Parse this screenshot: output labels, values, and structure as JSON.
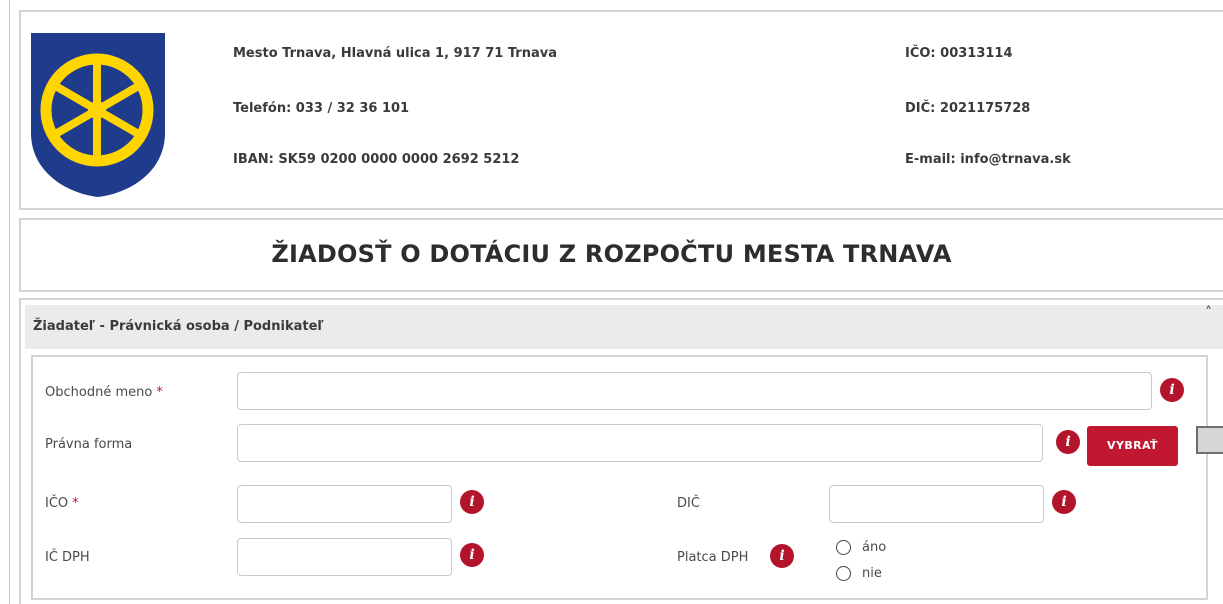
{
  "header": {
    "address": "Mesto Trnava, Hlavná ulica 1, 917 71 Trnava",
    "phone": "Telefón: 033 / 32 36 101",
    "iban": "IBAN: SK59 0200 0000 0000 2692 5212",
    "ico": "IČO: 00313114",
    "dic": "DIČ: 2021175728",
    "email": "E-mail: info@trnava.sk"
  },
  "colors": {
    "accent": "#c11730",
    "coat_blue": "#1f3c8c",
    "coat_yellow": "#ffd500"
  },
  "page_title": "ŽIADOSŤ O DOTÁCIU Z ROZPOČTU MESTA TRNAVA",
  "section": {
    "title": "Žiadateľ - Právnická osoba / Podnikateľ",
    "collapse_icon": "chevron-up-icon",
    "caret": "˄"
  },
  "form": {
    "obchodne_meno": {
      "label": "Obchodné meno",
      "required_mark": "*",
      "value": ""
    },
    "pravna_forma": {
      "label": "Právna forma",
      "value": "",
      "button": "VYBRAŤ"
    },
    "ico": {
      "label": "IČO",
      "required_mark": "*",
      "value": ""
    },
    "dic": {
      "label": "DIČ",
      "value": ""
    },
    "ic_dph": {
      "label": "IČ DPH",
      "value": ""
    },
    "platca_dph": {
      "label": "Platca DPH",
      "options": [
        "áno",
        "nie"
      ]
    },
    "info_icon": "i"
  }
}
